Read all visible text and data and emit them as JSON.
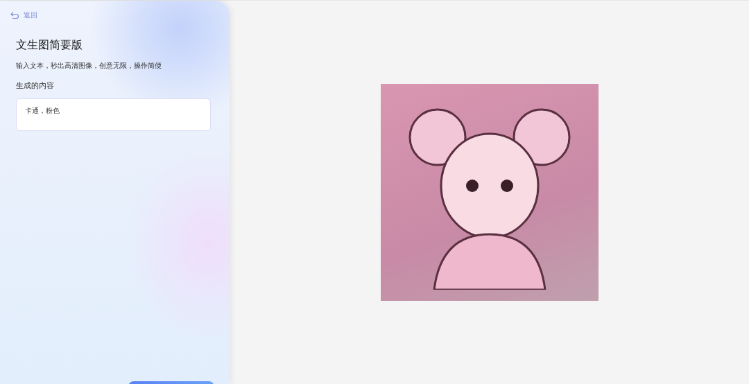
{
  "back_link": {
    "label": "返回"
  },
  "title": "文生图简要版",
  "subtitle": "输入文本，秒出高清图像，创意无限，操作简便",
  "prompt": {
    "label": "生成的内容",
    "value": "卡通，粉色"
  }
}
